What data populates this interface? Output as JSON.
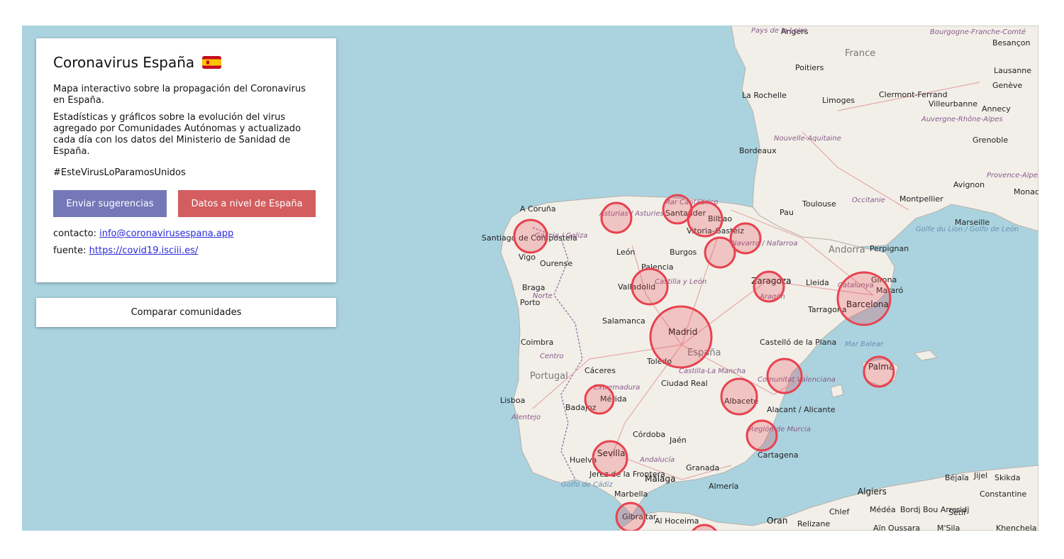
{
  "panel": {
    "title": "Coronavirus España",
    "flag_icon": "spain-flag-icon",
    "description_1": "Mapa interactivo sobre la propagación del Coronavirus en España.",
    "description_2": "Estadísticas y gráficos sobre la evolución del virus agregado por Comunidades Autónomas y actualizado cada día con los datos del Ministerio de Sanidad de España.",
    "hashtag": "#EsteVirusLoParamosUnidos",
    "button_suggestions": "Enviar sugerencias",
    "button_spain": "Datos a nivel de España",
    "contact_label": "contacto: ",
    "contact_email": "info@coronavirusespana.app",
    "source_label": "fuente: ",
    "source_url": "https://covid19.isciii.es/"
  },
  "compare_button": "Comparar comunidades",
  "colors": {
    "button_suggestions": "#7478b8",
    "button_spain": "#d35d5f",
    "circle_stroke": "#e8424f",
    "sea": "#aad3df",
    "land": "#f2efe9"
  },
  "map_labels": {
    "countries": [
      "France",
      "Portugal",
      "Andorra",
      "España"
    ],
    "cities": [
      "Angers",
      "Poitiers",
      "La Rochelle",
      "Limoges",
      "Clermont-Ferrand",
      "Villeurbanne",
      "Annecy",
      "Genève",
      "Lausanne",
      "Besançon",
      "Bordeaux",
      "Grenoble",
      "Avignon",
      "Montpellier",
      "Marseille",
      "Toulouse",
      "Pau",
      "Perpignan",
      "A Coruña",
      "Santiago de Compostela",
      "Vigo",
      "Ourense",
      "León",
      "Burgos",
      "Bilbao",
      "Santander",
      "Vitoria-Gasteiz",
      "Palencia",
      "Valladolid",
      "Braga",
      "Porto",
      "Salamanca",
      "Coimbra",
      "Madrid",
      "Toledo",
      "Cáceres",
      "Ciudad Real",
      "Lisboa",
      "Badajoz",
      "Mérida",
      "Córdoba",
      "Jaén",
      "Sevilla",
      "Huelva",
      "Granada",
      "Málaga",
      "Marbella",
      "Jerez de la Frontera",
      "Gibraltar",
      "Almería",
      "Cartagena",
      "Albacete",
      "Alacant / Alicante",
      "Castelló de la Plana",
      "Zaragoza",
      "Lleida",
      "Tarragona",
      "Barcelona",
      "Girona",
      "Mataró",
      "Palma",
      "Algiers",
      "Oran",
      "Chlef",
      "Médéa",
      "Bordj Bou Arreridj",
      "Sétif",
      "Constantine",
      "Béjaïa",
      "Jijel",
      "Skikda",
      "Al Hoceima",
      "Relizane",
      "Aïn Oussara",
      "M'Sila",
      "Khenchela",
      "Monaco"
    ],
    "regions": [
      "Pays de la Loire",
      "Bourgogne-Franche-Comté",
      "Nouvelle-Aquitaine",
      "Auvergne-Rhône-Alpes",
      "Occitanie",
      "Provence-Alpes-Côte d'Azur",
      "Galicia / Galiza",
      "Asturias / Asturies",
      "Mar Cantábrico",
      "Navarra / Nafarroa",
      "Castilla y León",
      "Aragón",
      "Catalunya",
      "Castilla-La Mancha",
      "Extremadura",
      "Comunitat Valenciana",
      "Región de Murcia",
      "Andalucía",
      "Norte",
      "Centro",
      "Alentejo"
    ],
    "seas": [
      "Golfe du Lion / Golfo de León",
      "Mar Balear",
      "Golfo de Cádiz"
    ]
  }
}
